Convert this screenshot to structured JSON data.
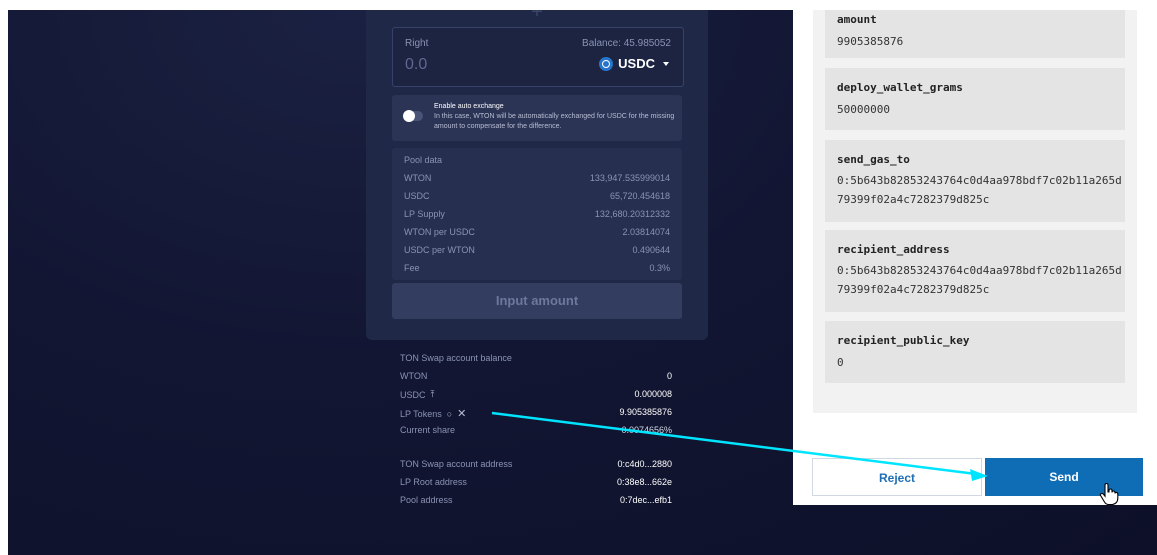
{
  "swap": {
    "right_label": "Right",
    "balance": "Balance: 45.985052",
    "amount": "0.0",
    "token": "USDC",
    "auto_exchange": {
      "title": "Enable auto exchange",
      "description": "In this case, WTON will be automatically exchanged for USDC for the missing amount to compensate for the difference."
    },
    "pool": {
      "heading": "Pool data",
      "rows": [
        {
          "label": "WTON",
          "value": "133,947.535999014"
        },
        {
          "label": "USDC",
          "value": "65,720.454618"
        },
        {
          "label": "LP Supply",
          "value": "132,680.20312332"
        },
        {
          "label": "WTON per USDC",
          "value": "2.03814074"
        },
        {
          "label": "USDC per WTON",
          "value": "0.490644"
        },
        {
          "label": "Fee",
          "value": "0.3%"
        }
      ]
    },
    "input_button": "Input amount"
  },
  "account": {
    "heading": "TON Swap account balance",
    "balances": [
      {
        "label": "WTON",
        "value": "0"
      },
      {
        "label": "USDC",
        "value": "0.000008",
        "icon": "upload-icon"
      },
      {
        "label": "LP Tokens",
        "value": "9.905385876",
        "icons": [
          "refresh-icon",
          "close-icon"
        ]
      },
      {
        "label": "Current share",
        "value": "0.0074656%"
      }
    ],
    "addresses": [
      {
        "label": "TON Swap account address",
        "value": "0:c4d0...2880"
      },
      {
        "label": "LP Root address",
        "value": "0:38e8...662e"
      },
      {
        "label": "Pool address",
        "value": "0:7dec...efb1"
      }
    ]
  },
  "wallet": {
    "params": [
      {
        "name": "amount",
        "value": "9905385876"
      },
      {
        "name": "deploy_wallet_grams",
        "value": "50000000"
      },
      {
        "name": "send_gas_to",
        "value": "0:5b643b82853243764c0d4aa978bdf7c02b11a265d79399f02a4c7282379d825c"
      },
      {
        "name": "recipient_address",
        "value": "0:5b643b82853243764c0d4aa978bdf7c02b11a265d79399f02a4c7282379d825c"
      },
      {
        "name": "recipient_public_key",
        "value": "0"
      }
    ],
    "reject": "Reject",
    "send": "Send"
  },
  "colors": {
    "background": "#121633",
    "card": "#1f2847",
    "accent_blue": "#0f6db6",
    "arrow": "#00e5ff"
  }
}
